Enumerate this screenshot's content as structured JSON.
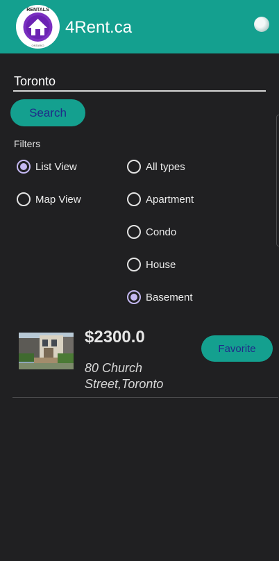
{
  "header": {
    "logo_top_text": "RENTALS",
    "logo_bottom_text": "ONTARIO",
    "app_title": "4Rent.ca",
    "brand_color": "#14a08f"
  },
  "search": {
    "value": "Toronto",
    "button_label": "Search"
  },
  "filters": {
    "label": "Filters",
    "view_options": [
      {
        "label": "List View",
        "selected": true
      },
      {
        "label": "Map View",
        "selected": false
      }
    ],
    "type_options": [
      {
        "label": "All types",
        "selected": false
      },
      {
        "label": "Apartment",
        "selected": false
      },
      {
        "label": "Condo",
        "selected": false
      },
      {
        "label": "House",
        "selected": false
      },
      {
        "label": "Basement",
        "selected": true
      }
    ]
  },
  "listings": [
    {
      "price": "$2300.0",
      "address": "80 Church Street,Toronto",
      "favorite_label": "Favorite"
    }
  ]
}
